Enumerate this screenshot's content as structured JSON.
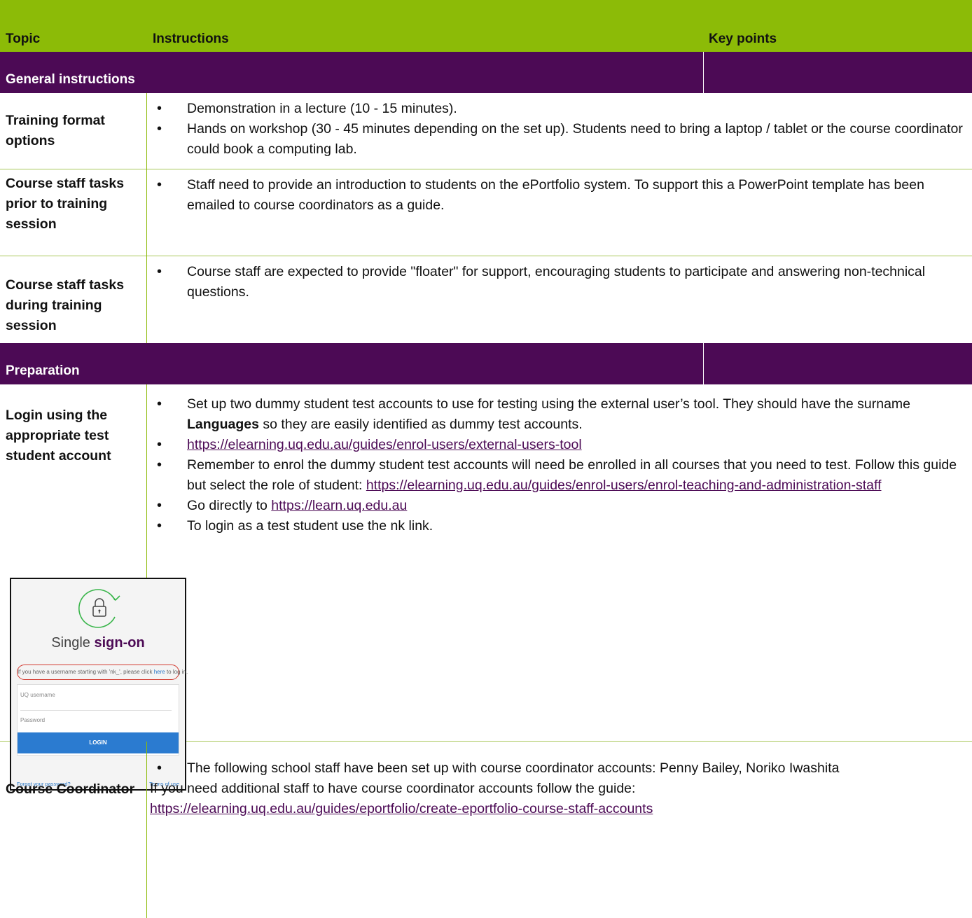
{
  "header": {
    "topic": "Topic",
    "instructions": "Instructions",
    "key_points": "Key points"
  },
  "sections": [
    {
      "title": "General instructions"
    },
    {
      "title": "Preparation"
    }
  ],
  "rows": {
    "training_format": {
      "topic": "Training  format options",
      "b1": "Demonstration in a lecture (10 - 15 minutes).",
      "b2": "Hands on workshop (30 - 45 minutes depending on the set up). Students need to bring a laptop / tablet or the course coordinator could book a computing lab."
    },
    "staff_prior": {
      "topic": "Course staff tasks prior to training session",
      "b1": "Staff need to provide an introduction to students on the ePortfolio system. To support this a PowerPoint template has been emailed to course coordinators as a guide."
    },
    "staff_during": {
      "topic": "Course staff tasks during training session",
      "b1": "Course staff are expected to provide \"floater\" for support, encouraging students to participate and answering non-technical questions."
    },
    "login": {
      "topic": "Login using the appropriate test student account",
      "b1_pre": "Set up two dummy student test accounts to use for testing using the external user’s tool. They should have the surname ",
      "b1_bold": "Languages",
      "b1_post": " so they are easily identified as dummy test accounts.",
      "b2_link": "https://elearning.uq.edu.au/guides/enrol-users/external-users-tool",
      "b3_pre": "Remember to enrol the dummy student test accounts will need be enrolled in all courses that you need to test. Follow this guide but select the role of student: ",
      "b3_link": "https://elearning.uq.edu.au/guides/enrol-users/enrol-teaching-and-administration-staff",
      "b4_pre": "Go directly to ",
      "b4_link": "https://learn.uq.edu.au",
      "b5": "To login as a test student use the nk link."
    },
    "coordinator": {
      "topic": "Course Coordinator",
      "b1": "The following school staff have been set up with course coordinator accounts: Penny Bailey, Noriko Iwashita",
      "p1": "If you need additional staff to have course coordinator accounts follow the guide:",
      "link": "https://elearning.uq.edu.au/guides/eportfolio/create-eportfolio-course-staff-accounts"
    }
  },
  "sso": {
    "icon": "lock-refresh-icon",
    "title_pre": "Single ",
    "title_bold": "sign-on",
    "nk_pre": "If you have a username starting with 'nk_', please click ",
    "nk_link": "here",
    "nk_post": " to log in.",
    "username_placeholder": "UQ username",
    "password_placeholder": "Password",
    "login_label": "LOGIN",
    "forgot": "Forgot your password?",
    "terms": "Terms of use"
  },
  "colors": {
    "header_green": "#8cbb07",
    "section_purple": "#4c0a55",
    "link": "#4c0a55"
  }
}
